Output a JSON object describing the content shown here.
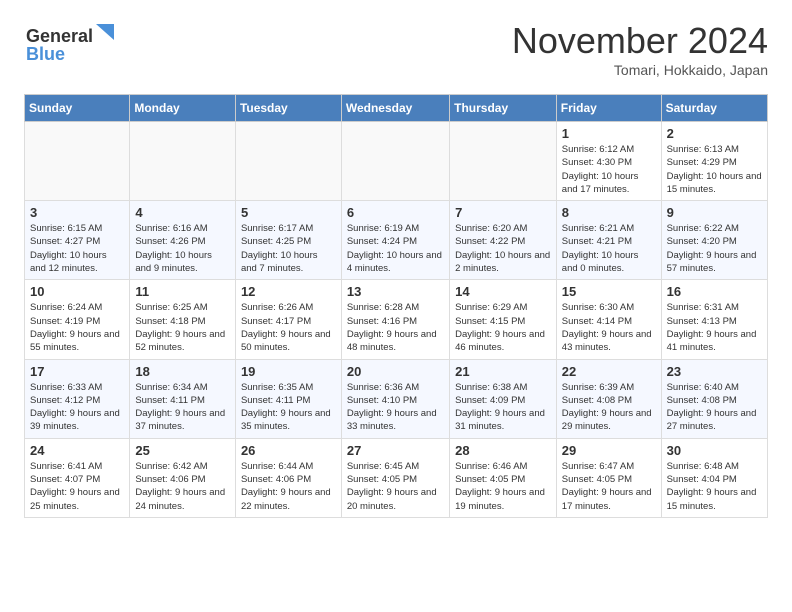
{
  "header": {
    "logo_line1": "General",
    "logo_line2": "Blue",
    "month_title": "November 2024",
    "location": "Tomari, Hokkaido, Japan"
  },
  "weekdays": [
    "Sunday",
    "Monday",
    "Tuesday",
    "Wednesday",
    "Thursday",
    "Friday",
    "Saturday"
  ],
  "weeks": [
    [
      {
        "day": "",
        "info": ""
      },
      {
        "day": "",
        "info": ""
      },
      {
        "day": "",
        "info": ""
      },
      {
        "day": "",
        "info": ""
      },
      {
        "day": "",
        "info": ""
      },
      {
        "day": "1",
        "info": "Sunrise: 6:12 AM\nSunset: 4:30 PM\nDaylight: 10 hours and 17 minutes."
      },
      {
        "day": "2",
        "info": "Sunrise: 6:13 AM\nSunset: 4:29 PM\nDaylight: 10 hours and 15 minutes."
      }
    ],
    [
      {
        "day": "3",
        "info": "Sunrise: 6:15 AM\nSunset: 4:27 PM\nDaylight: 10 hours and 12 minutes."
      },
      {
        "day": "4",
        "info": "Sunrise: 6:16 AM\nSunset: 4:26 PM\nDaylight: 10 hours and 9 minutes."
      },
      {
        "day": "5",
        "info": "Sunrise: 6:17 AM\nSunset: 4:25 PM\nDaylight: 10 hours and 7 minutes."
      },
      {
        "day": "6",
        "info": "Sunrise: 6:19 AM\nSunset: 4:24 PM\nDaylight: 10 hours and 4 minutes."
      },
      {
        "day": "7",
        "info": "Sunrise: 6:20 AM\nSunset: 4:22 PM\nDaylight: 10 hours and 2 minutes."
      },
      {
        "day": "8",
        "info": "Sunrise: 6:21 AM\nSunset: 4:21 PM\nDaylight: 10 hours and 0 minutes."
      },
      {
        "day": "9",
        "info": "Sunrise: 6:22 AM\nSunset: 4:20 PM\nDaylight: 9 hours and 57 minutes."
      }
    ],
    [
      {
        "day": "10",
        "info": "Sunrise: 6:24 AM\nSunset: 4:19 PM\nDaylight: 9 hours and 55 minutes."
      },
      {
        "day": "11",
        "info": "Sunrise: 6:25 AM\nSunset: 4:18 PM\nDaylight: 9 hours and 52 minutes."
      },
      {
        "day": "12",
        "info": "Sunrise: 6:26 AM\nSunset: 4:17 PM\nDaylight: 9 hours and 50 minutes."
      },
      {
        "day": "13",
        "info": "Sunrise: 6:28 AM\nSunset: 4:16 PM\nDaylight: 9 hours and 48 minutes."
      },
      {
        "day": "14",
        "info": "Sunrise: 6:29 AM\nSunset: 4:15 PM\nDaylight: 9 hours and 46 minutes."
      },
      {
        "day": "15",
        "info": "Sunrise: 6:30 AM\nSunset: 4:14 PM\nDaylight: 9 hours and 43 minutes."
      },
      {
        "day": "16",
        "info": "Sunrise: 6:31 AM\nSunset: 4:13 PM\nDaylight: 9 hours and 41 minutes."
      }
    ],
    [
      {
        "day": "17",
        "info": "Sunrise: 6:33 AM\nSunset: 4:12 PM\nDaylight: 9 hours and 39 minutes."
      },
      {
        "day": "18",
        "info": "Sunrise: 6:34 AM\nSunset: 4:11 PM\nDaylight: 9 hours and 37 minutes."
      },
      {
        "day": "19",
        "info": "Sunrise: 6:35 AM\nSunset: 4:11 PM\nDaylight: 9 hours and 35 minutes."
      },
      {
        "day": "20",
        "info": "Sunrise: 6:36 AM\nSunset: 4:10 PM\nDaylight: 9 hours and 33 minutes."
      },
      {
        "day": "21",
        "info": "Sunrise: 6:38 AM\nSunset: 4:09 PM\nDaylight: 9 hours and 31 minutes."
      },
      {
        "day": "22",
        "info": "Sunrise: 6:39 AM\nSunset: 4:08 PM\nDaylight: 9 hours and 29 minutes."
      },
      {
        "day": "23",
        "info": "Sunrise: 6:40 AM\nSunset: 4:08 PM\nDaylight: 9 hours and 27 minutes."
      }
    ],
    [
      {
        "day": "24",
        "info": "Sunrise: 6:41 AM\nSunset: 4:07 PM\nDaylight: 9 hours and 25 minutes."
      },
      {
        "day": "25",
        "info": "Sunrise: 6:42 AM\nSunset: 4:06 PM\nDaylight: 9 hours and 24 minutes."
      },
      {
        "day": "26",
        "info": "Sunrise: 6:44 AM\nSunset: 4:06 PM\nDaylight: 9 hours and 22 minutes."
      },
      {
        "day": "27",
        "info": "Sunrise: 6:45 AM\nSunset: 4:05 PM\nDaylight: 9 hours and 20 minutes."
      },
      {
        "day": "28",
        "info": "Sunrise: 6:46 AM\nSunset: 4:05 PM\nDaylight: 9 hours and 19 minutes."
      },
      {
        "day": "29",
        "info": "Sunrise: 6:47 AM\nSunset: 4:05 PM\nDaylight: 9 hours and 17 minutes."
      },
      {
        "day": "30",
        "info": "Sunrise: 6:48 AM\nSunset: 4:04 PM\nDaylight: 9 hours and 15 minutes."
      }
    ]
  ]
}
